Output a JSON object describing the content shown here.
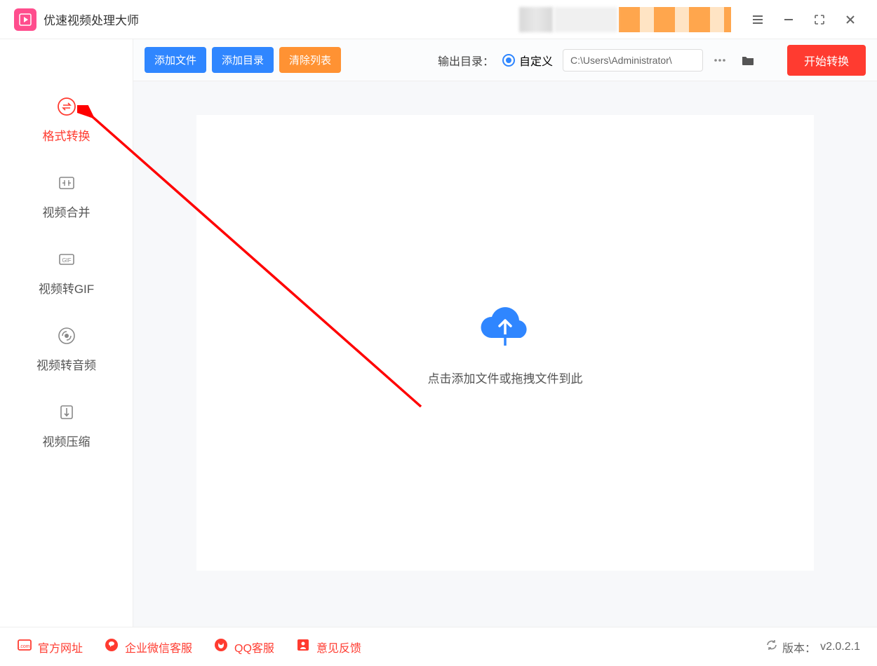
{
  "app": {
    "title": "优速视频处理大师"
  },
  "sidebar": {
    "items": [
      {
        "label": "格式转换",
        "icon": "convert-icon",
        "active": true
      },
      {
        "label": "视频合并",
        "icon": "merge-icon",
        "active": false
      },
      {
        "label": "视频转GIF",
        "icon": "gif-icon",
        "active": false
      },
      {
        "label": "视频转音频",
        "icon": "audio-icon",
        "active": false
      },
      {
        "label": "视频压缩",
        "icon": "compress-icon",
        "active": false
      }
    ]
  },
  "toolbar": {
    "add_file_label": "添加文件",
    "add_folder_label": "添加目录",
    "clear_list_label": "清除列表",
    "output_dir_label": "输出目录：",
    "custom_label": "自定义",
    "path_value": "C:\\Users\\Administrator\\",
    "start_label": "开始转换"
  },
  "dropzone": {
    "text": "点击添加文件或拖拽文件到此"
  },
  "footer": {
    "official_site_label": "官方网址",
    "wechat_support_label": "企业微信客服",
    "qq_support_label": "QQ客服",
    "feedback_label": "意见反馈",
    "version_prefix": "版本：",
    "version_value": "v2.0.2.1"
  },
  "colors": {
    "accent_red": "#ff3b30",
    "accent_blue": "#2f86ff",
    "accent_orange": "#ff9233",
    "pink": "#ff4d8d"
  }
}
